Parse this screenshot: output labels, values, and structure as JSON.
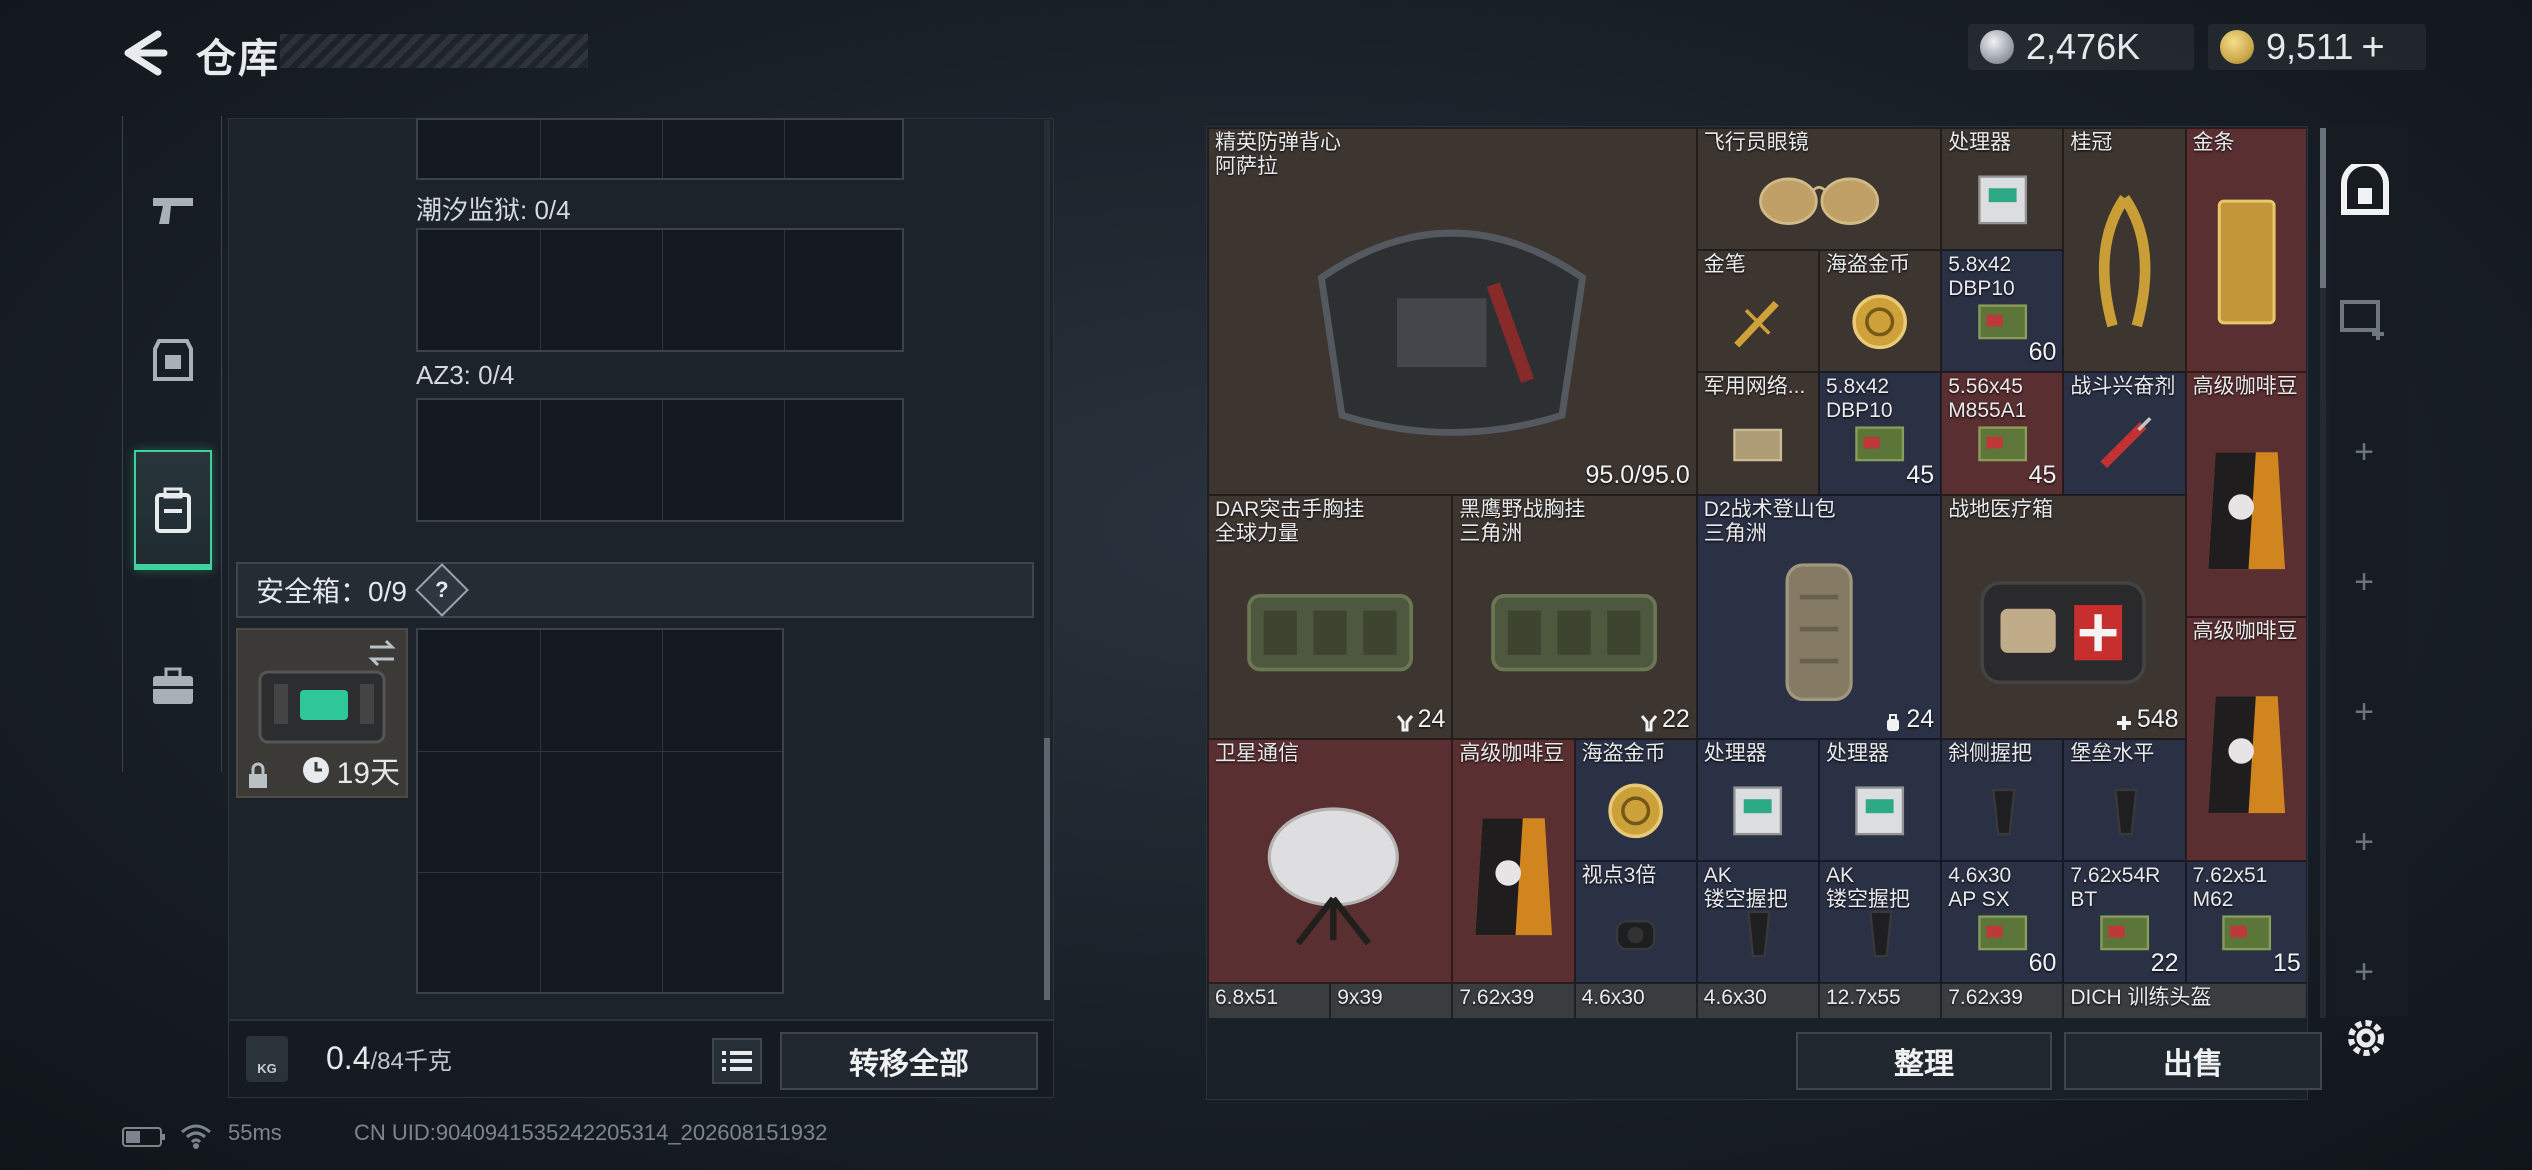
{
  "header": {
    "title": "仓库",
    "currency": [
      {
        "value": "2,476K",
        "icon": "silver-coin-icon",
        "color": "#c7ccd2"
      },
      {
        "value": "9,511",
        "suffix": "+",
        "icon": "gold-coin-icon",
        "color": "#c9a548"
      }
    ]
  },
  "left": {
    "sections": [
      {
        "label": "潮汐监狱: 0/4"
      },
      {
        "label": "AZ3: 0/4"
      }
    ],
    "safe_box": {
      "label": "安全箱：0/9",
      "help": "?",
      "days": "19天"
    },
    "weight": {
      "current": "0.4",
      "max": "/84千克",
      "kg_icon": "KG"
    },
    "transfer_all": "转移全部"
  },
  "items": [
    {
      "name": "精英防弹背心\n阿萨拉",
      "count": "95.0/95.0",
      "color": "brown",
      "icon": "armor-vest-icon"
    },
    {
      "name": "飞行员眼镜",
      "count": "",
      "color": "brown",
      "icon": "aviator-glasses-icon"
    },
    {
      "name": "处理器",
      "count": "",
      "color": "brown",
      "icon": "processor-icon"
    },
    {
      "name": "桂冠",
      "count": "",
      "color": "brown",
      "icon": "laurel-crown-icon"
    },
    {
      "name": "金条",
      "count": "",
      "color": "red",
      "icon": "gold-bar-icon"
    },
    {
      "name": "金笔",
      "count": "",
      "color": "brown",
      "icon": "gold-pen-icon"
    },
    {
      "name": "海盗金币",
      "count": "",
      "color": "brown",
      "icon": "pirate-coin-icon"
    },
    {
      "name": "5.8x42\nDBP10",
      "count": "60",
      "color": "navy",
      "icon": "ammo-box-icon"
    },
    {
      "name": "军用网络...",
      "count": "",
      "color": "brown",
      "icon": "network-device-icon"
    },
    {
      "name": "5.8x42\nDBP10",
      "count": "45",
      "color": "navy",
      "icon": "ammo-box-icon"
    },
    {
      "name": "5.56x45\nM855A1",
      "count": "45",
      "color": "red",
      "icon": "ammo-box-icon"
    },
    {
      "name": "战斗兴奋剂",
      "count": "",
      "color": "navy",
      "icon": "stim-injector-icon"
    },
    {
      "name": "高级咖啡豆",
      "count": "",
      "color": "red",
      "icon": "coffee-bag-icon"
    },
    {
      "name": "DAR突击手胸挂\n全球力量",
      "count": "24",
      "count_icon": "vest-slot-icon",
      "color": "brown",
      "icon": "chest-rig-icon"
    },
    {
      "name": "黑鹰野战胸挂\n三角洲",
      "count": "22",
      "count_icon": "vest-slot-icon",
      "color": "brown",
      "icon": "chest-rig-icon"
    },
    {
      "name": "D2战术登山包\n三角洲",
      "count": "24",
      "count_icon": "backpack-slot-icon",
      "color": "navy",
      "icon": "backpack-icon"
    },
    {
      "name": "战地医疗箱",
      "count": "548",
      "count_icon": "plus-icon",
      "color": "brown",
      "icon": "medkit-icon"
    },
    {
      "name": "高级咖啡豆",
      "count": "",
      "color": "red",
      "icon": "coffee-bag-icon"
    },
    {
      "name": "卫星通信",
      "count": "",
      "color": "red",
      "icon": "satellite-dish-icon"
    },
    {
      "name": "高级咖啡豆",
      "count": "",
      "color": "red",
      "icon": "coffee-bag-icon"
    },
    {
      "name": "海盗金币",
      "count": "",
      "color": "navy",
      "icon": "pirate-coin-icon"
    },
    {
      "name": "处理器",
      "count": "",
      "color": "navy",
      "icon": "processor-icon"
    },
    {
      "name": "处理器",
      "count": "",
      "color": "navy",
      "icon": "processor-icon"
    },
    {
      "name": "斜侧握把",
      "count": "",
      "color": "navy",
      "icon": "grip-icon"
    },
    {
      "name": "堡垒水平",
      "count": "",
      "color": "navy",
      "icon": "grip-icon"
    },
    {
      "name": "视点3倍",
      "count": "",
      "color": "navy",
      "icon": "scope-icon"
    },
    {
      "name": "AK\n镂空握把",
      "count": "",
      "color": "navy",
      "icon": "grip-icon"
    },
    {
      "name": "AK\n镂空握把",
      "count": "",
      "color": "navy",
      "icon": "grip-icon"
    },
    {
      "name": "4.6x30\nAP SX",
      "count": "60",
      "color": "navy",
      "icon": "ammo-box-icon"
    },
    {
      "name": "7.62x54R\nBT",
      "count": "22",
      "color": "navy",
      "icon": "ammo-box-icon"
    },
    {
      "name": "7.62x51\nM62",
      "count": "15",
      "color": "navy",
      "icon": "ammo-box-icon"
    },
    {
      "name": "6.8x51",
      "count": "",
      "color": "slate",
      "icon": ""
    },
    {
      "name": "9x39",
      "count": "",
      "color": "slate",
      "icon": ""
    },
    {
      "name": "7.62x39",
      "count": "",
      "color": "slate",
      "icon": ""
    },
    {
      "name": "4.6x30",
      "count": "",
      "color": "slate",
      "icon": ""
    },
    {
      "name": "4.6x30",
      "count": "",
      "color": "slate",
      "icon": ""
    },
    {
      "name": "12.7x55",
      "count": "",
      "color": "slate",
      "icon": ""
    },
    {
      "name": "7.62x39",
      "count": "",
      "color": "slate",
      "icon": ""
    },
    {
      "name": "DICH 训练头盔",
      "count": "",
      "color": "slate",
      "icon": ""
    }
  ],
  "right_actions": {
    "sort": "整理",
    "sell": "出售"
  },
  "status": {
    "ping": "55ms",
    "uid": "CN UID:9040941535242205314_202608151932"
  }
}
